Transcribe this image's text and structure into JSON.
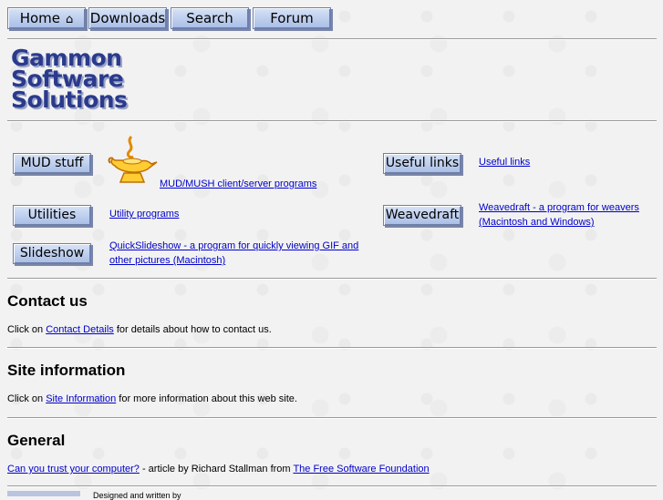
{
  "nav": {
    "home": "Home",
    "downloads": "Downloads",
    "search": "Search",
    "forum": "Forum"
  },
  "logo": {
    "line1": "Gammon",
    "line2": "Software",
    "line3": "Solutions"
  },
  "sections": {
    "mud_button": "MUD stuff",
    "mud_link": "MUD/MUSH client/server programs",
    "useful_button": "Useful links",
    "useful_link": "Useful links",
    "utilities_button": "Utilities",
    "utilities_link": "Utility programs",
    "weavedraft_button": "Weavedraft",
    "weavedraft_link_1": "Weavedraft - a program for weavers",
    "weavedraft_link_2": "(Macintosh and Windows)",
    "slideshow_button": "Slideshow",
    "slideshow_link_1": "QuickSlideshow - a program for quickly viewing GIF and",
    "slideshow_link_2": "other pictures (Macintosh)"
  },
  "contact": {
    "heading": "Contact us",
    "prefix": "Click on ",
    "link": "Contact Details",
    "suffix": " for details about how to contact us."
  },
  "site_info": {
    "heading": "Site information",
    "prefix": "Click on ",
    "link": "Site Information",
    "suffix": " for more information about this web site."
  },
  "general": {
    "heading": "General",
    "link1": "Can you trust your computer?",
    "middle": " - article by Richard Stallman from ",
    "link2": "The Free Software Foundation"
  },
  "footer": {
    "text": "Designed and written by"
  }
}
